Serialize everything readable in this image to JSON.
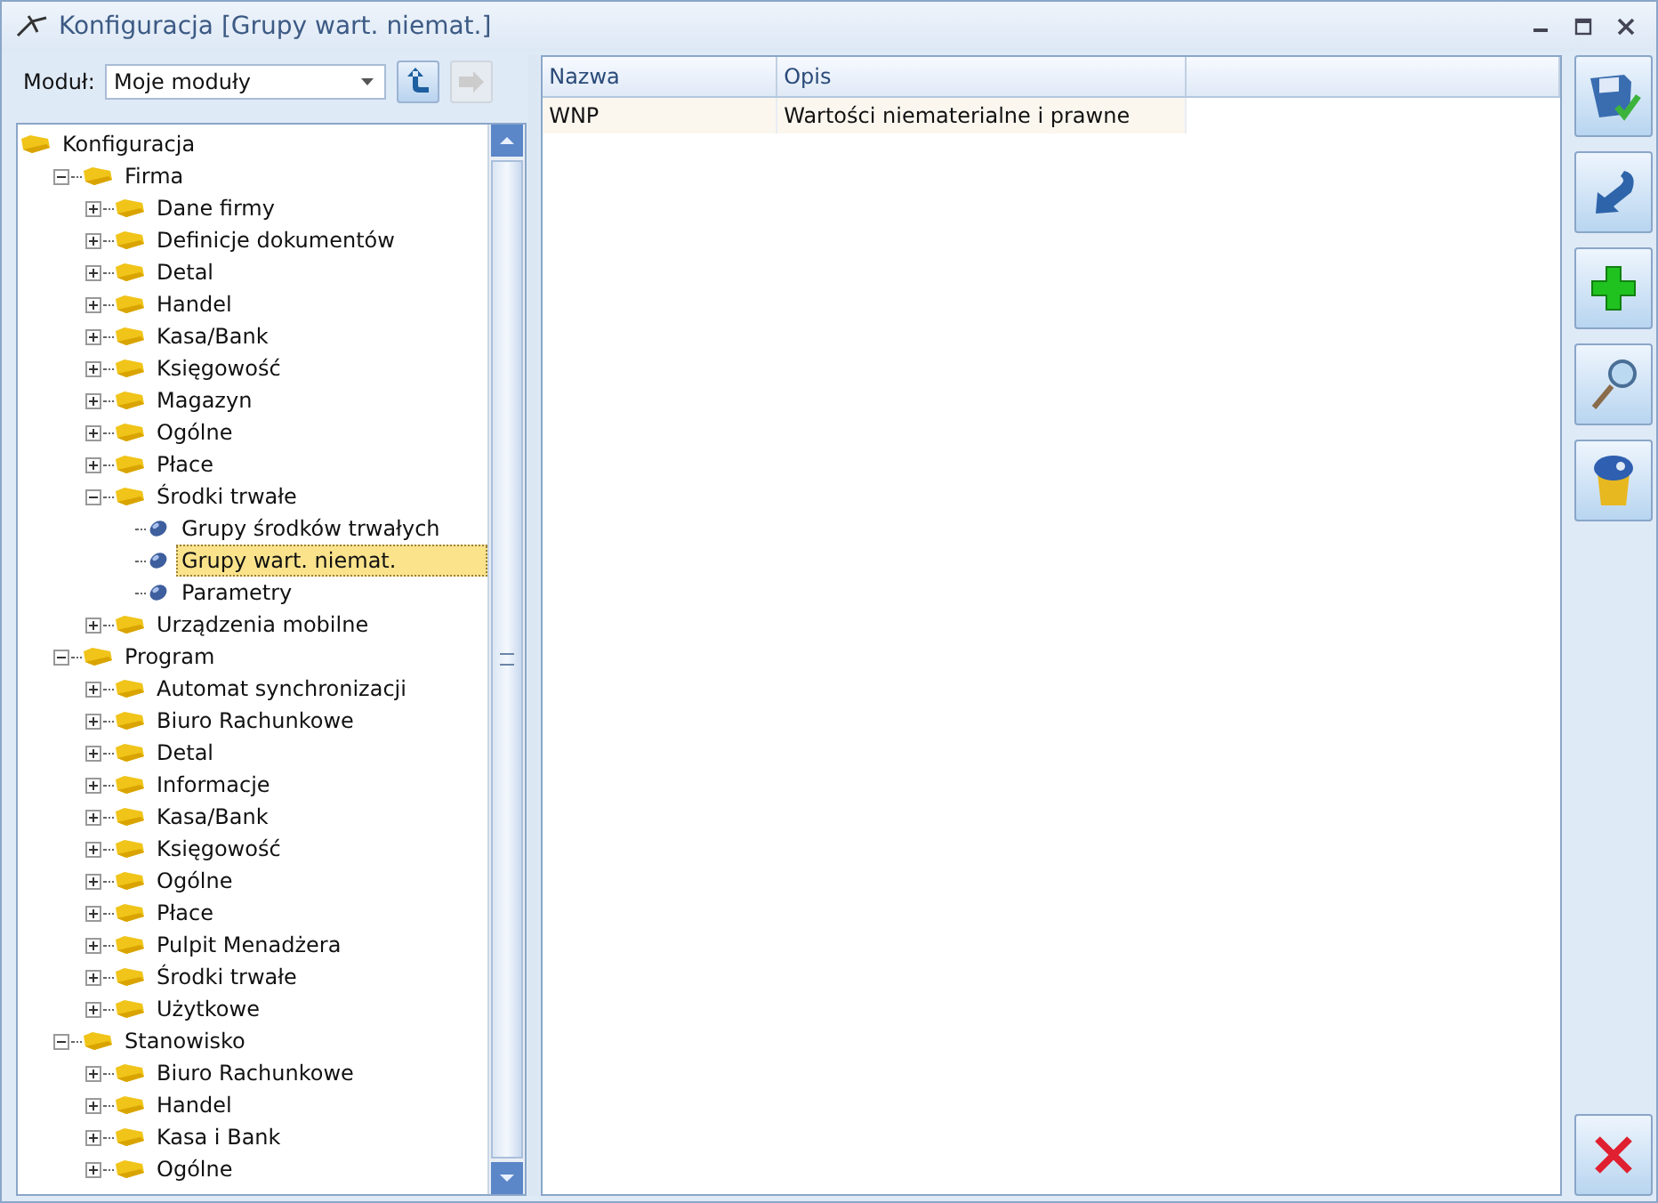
{
  "window": {
    "title": "Konfiguracja [Grupy wart. niemat.]"
  },
  "module": {
    "label": "Moduł:",
    "value": "Moje moduły"
  },
  "tree": {
    "label": "Konfiguracja",
    "kind": "folder",
    "selected": false,
    "children": [
      {
        "label": "Firma",
        "kind": "folder",
        "expanded": true,
        "selected": false,
        "children": [
          {
            "label": "Dane firmy",
            "kind": "folder",
            "expanded": false,
            "selected": false
          },
          {
            "label": "Definicje dokumentów",
            "kind": "folder",
            "expanded": false,
            "selected": false
          },
          {
            "label": "Detal",
            "kind": "folder",
            "expanded": false,
            "selected": false
          },
          {
            "label": "Handel",
            "kind": "folder",
            "expanded": false,
            "selected": false
          },
          {
            "label": "Kasa/Bank",
            "kind": "folder",
            "expanded": false,
            "selected": false
          },
          {
            "label": "Księgowość",
            "kind": "folder",
            "expanded": false,
            "selected": false
          },
          {
            "label": "Magazyn",
            "kind": "folder",
            "expanded": false,
            "selected": false
          },
          {
            "label": "Ogólne",
            "kind": "folder",
            "expanded": false,
            "selected": false
          },
          {
            "label": "Płace",
            "kind": "folder",
            "expanded": false,
            "selected": false
          },
          {
            "label": "Środki trwałe",
            "kind": "folder",
            "expanded": true,
            "selected": false,
            "children": [
              {
                "label": "Grupy środków trwałych",
                "kind": "leaf",
                "selected": false
              },
              {
                "label": "Grupy wart. niemat.",
                "kind": "leaf",
                "selected": true
              },
              {
                "label": "Parametry",
                "kind": "leaf",
                "selected": false
              }
            ]
          },
          {
            "label": "Urządzenia mobilne",
            "kind": "folder",
            "expanded": false,
            "selected": false
          }
        ]
      },
      {
        "label": "Program",
        "kind": "folder",
        "expanded": true,
        "selected": false,
        "children": [
          {
            "label": "Automat synchronizacji",
            "kind": "folder",
            "expanded": false,
            "selected": false
          },
          {
            "label": "Biuro Rachunkowe",
            "kind": "folder",
            "expanded": false,
            "selected": false
          },
          {
            "label": "Detal",
            "kind": "folder",
            "expanded": false,
            "selected": false
          },
          {
            "label": "Informacje",
            "kind": "folder",
            "expanded": false,
            "selected": false
          },
          {
            "label": "Kasa/Bank",
            "kind": "folder",
            "expanded": false,
            "selected": false
          },
          {
            "label": "Księgowość",
            "kind": "folder",
            "expanded": false,
            "selected": false
          },
          {
            "label": "Ogólne",
            "kind": "folder",
            "expanded": false,
            "selected": false
          },
          {
            "label": "Płace",
            "kind": "folder",
            "expanded": false,
            "selected": false
          },
          {
            "label": "Pulpit Menadżera",
            "kind": "folder",
            "expanded": false,
            "selected": false
          },
          {
            "label": "Środki trwałe",
            "kind": "folder",
            "expanded": false,
            "selected": false
          },
          {
            "label": "Użytkowe",
            "kind": "folder",
            "expanded": false,
            "selected": false
          }
        ]
      },
      {
        "label": "Stanowisko",
        "kind": "folder",
        "expanded": true,
        "selected": false,
        "children": [
          {
            "label": "Biuro Rachunkowe",
            "kind": "folder",
            "expanded": false,
            "selected": false
          },
          {
            "label": "Handel",
            "kind": "folder",
            "expanded": false,
            "selected": false
          },
          {
            "label": "Kasa i Bank",
            "kind": "folder",
            "expanded": false,
            "selected": false
          },
          {
            "label": "Ogólne",
            "kind": "folder",
            "expanded": false,
            "selected": false
          }
        ]
      }
    ]
  },
  "table": {
    "columns": [
      "Nazwa",
      "Opis"
    ],
    "rows": [
      {
        "cells": [
          "WNP",
          "Wartości niematerialne i prawne"
        ]
      }
    ]
  },
  "toolbar": [
    {
      "kind": "save"
    },
    {
      "kind": "undo"
    },
    {
      "kind": "add"
    },
    {
      "kind": "search"
    },
    {
      "kind": "delete"
    }
  ],
  "close_action": {
    "kind": "cancel"
  }
}
